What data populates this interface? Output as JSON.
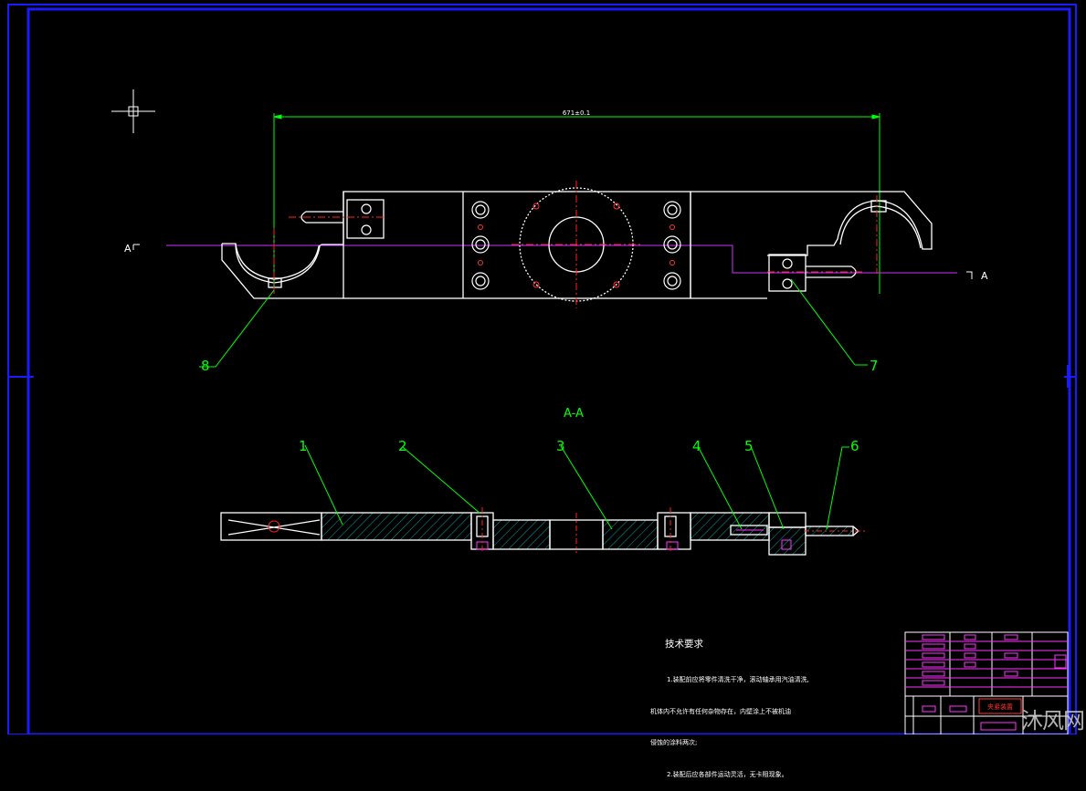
{
  "drawing": {
    "dimension_label": "671±0.1",
    "section_mark_left": "A",
    "section_mark_right": "A",
    "section_title": "A-A",
    "part_numbers": {
      "p1": "1",
      "p2": "2",
      "p3": "3",
      "p4": "4",
      "p5": "5",
      "p6": "6",
      "p7": "7",
      "p8": "8"
    }
  },
  "tech_requirements": {
    "title": "技术要求",
    "line1": "1.装配前应将零件清洗干净，滚动轴承用汽油清洗,",
    "line2": "机体内不允许有任何杂物存在，内壁涂上不被机油",
    "line3": "侵蚀的涂料两次;",
    "line4": "2.装配后应各部件运动灵活，无卡阻现象。"
  },
  "title_block": {
    "name_cell": "夹紧装置"
  },
  "watermark": "沐风网",
  "colors": {
    "background": "#000000",
    "frame": "#1a1aff",
    "outline": "#ffffff",
    "dimension": "#00ff00",
    "centerline": "#ff2222",
    "section_line": "#cc33ff",
    "hatch": "#00cccc",
    "part_label": "#00ff00"
  }
}
